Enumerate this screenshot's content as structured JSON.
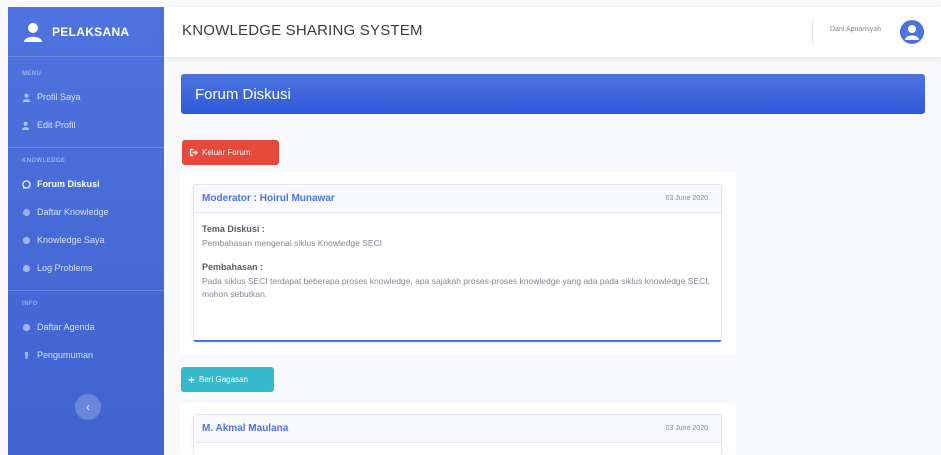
{
  "sidebar": {
    "brand": "PELAKSANA",
    "sections": [
      {
        "heading": "MENU",
        "items": [
          {
            "label": "Profil Saya",
            "icon": "user-icon",
            "active": false
          },
          {
            "label": "Edit Profil",
            "icon": "user-edit-icon",
            "active": false
          }
        ]
      },
      {
        "heading": "KNOWLEDGE",
        "items": [
          {
            "label": "Forum Diskusi",
            "icon": "comment-icon",
            "active": true
          },
          {
            "label": "Daftar Knowledge",
            "icon": "folder-icon",
            "active": false
          },
          {
            "label": "Knowledge Saya",
            "icon": "book-icon",
            "active": false
          },
          {
            "label": "Log Problems",
            "icon": "list-icon",
            "active": false
          }
        ]
      },
      {
        "heading": "INFO",
        "items": [
          {
            "label": "Daftar Agenda",
            "icon": "calendar-icon",
            "active": false
          },
          {
            "label": "Pengumuman",
            "icon": "bullhorn-icon",
            "active": false
          }
        ]
      }
    ],
    "toggle_icon": "chevron-left-icon"
  },
  "topbar": {
    "title": "KNOWLEDGE SHARING SYSTEM",
    "user_name": "Dani Apriansyah"
  },
  "page": {
    "header": "Forum Diskusi",
    "exit_button": "Keluar Forum",
    "add_button": "Beri Gagasan"
  },
  "posts": [
    {
      "author": "Moderator : Hoirul Munawar",
      "date": "03 June 2020",
      "topic_label": "Tema Diskusi :",
      "topic": "Pembahasan mengenai siklus Knowledge SECI",
      "discussion_label": "Pembahasan :",
      "discussion": "Pada siklus SECI terdapat beberapa proses knowledge, apa sajakah proses-proses knowledge yang ada pada siklus knowledge SECI, mohon sebutkan."
    },
    {
      "author": "M. Akmal Maulana",
      "date": "03 June 2020"
    }
  ],
  "colors": {
    "primary": "#4e73df",
    "danger": "#e74a3b",
    "info": "#36b9cc"
  }
}
